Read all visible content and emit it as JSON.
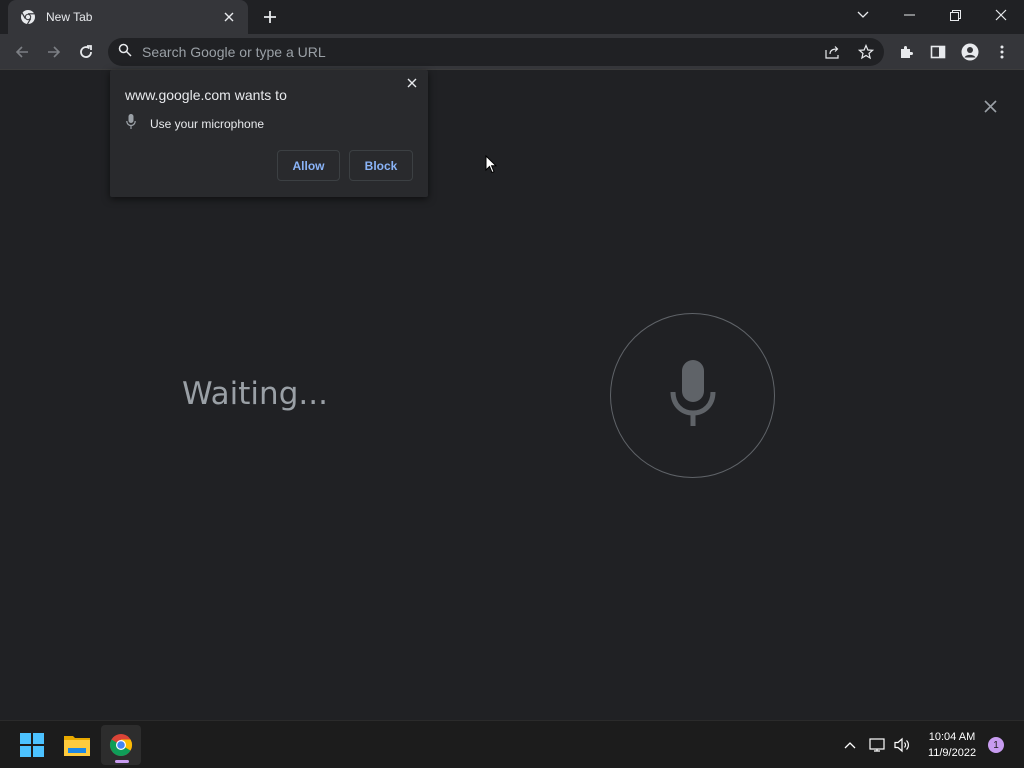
{
  "tab": {
    "title": "New Tab",
    "favicon": "chrome-icon"
  },
  "omnibox": {
    "placeholder": "Search Google or type a URL",
    "value": ""
  },
  "popup": {
    "title": "www.google.com wants to",
    "permission": "Use your microphone",
    "allow_label": "Allow",
    "block_label": "Block"
  },
  "voice": {
    "status": "Waiting..."
  },
  "taskbar": {
    "time": "10:04 AM",
    "date": "11/9/2022",
    "notification_count": "1"
  },
  "colors": {
    "background": "#202124",
    "toolbar": "#35363a",
    "accent": "#8ab4f8",
    "notification": "#c89cf0"
  }
}
